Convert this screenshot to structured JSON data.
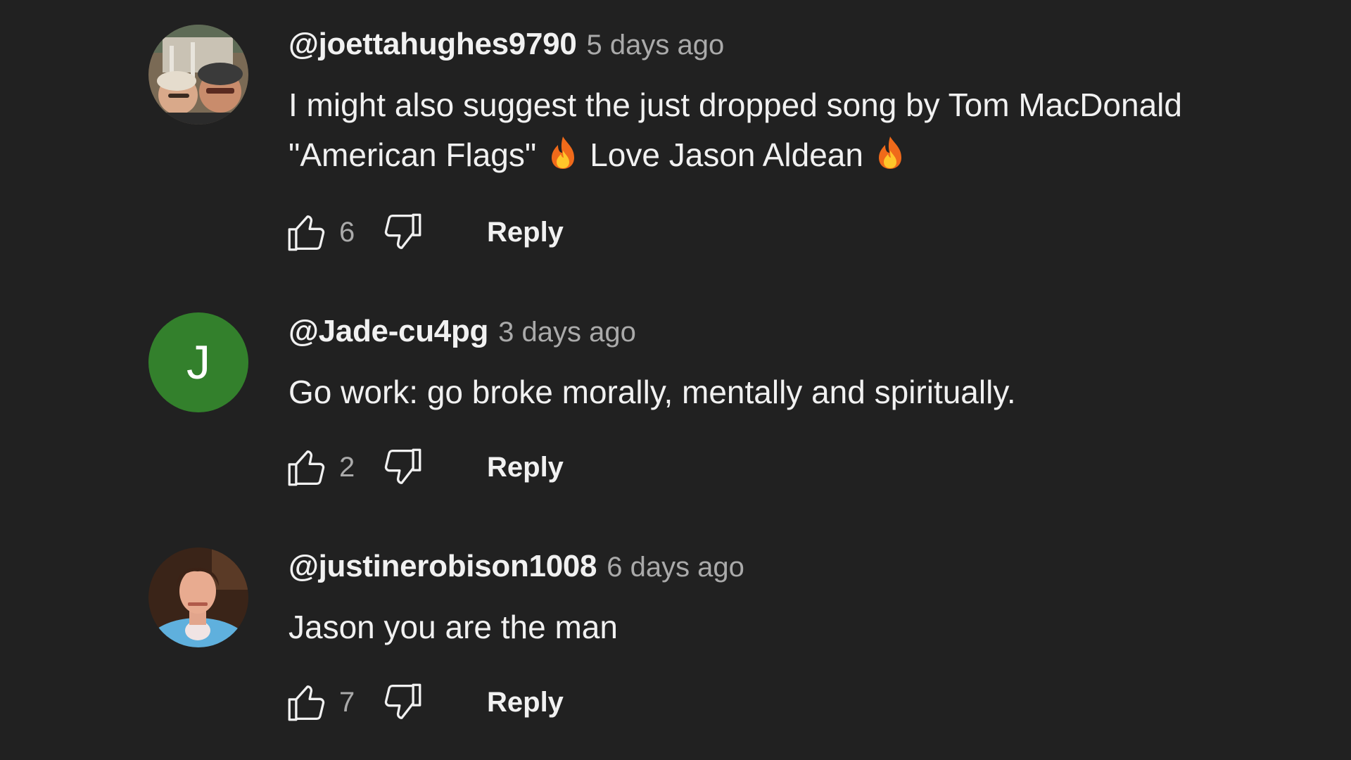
{
  "comments": [
    {
      "author": "@joettahughes9790",
      "time": "5 days ago",
      "text_part1": "I might also suggest the just dropped song by Tom MacDonald \"American Flags\"",
      "text_part2": "Love Jason Aldean",
      "emoji": "fire-emoji",
      "likes": "6",
      "reply_label": "Reply",
      "avatar_type": "photo"
    },
    {
      "author": "@Jade-cu4pg",
      "time": "3 days ago",
      "text": "Go work: go broke morally, mentally and spiritually.",
      "likes": "2",
      "reply_label": "Reply",
      "avatar_type": "letter",
      "avatar_letter": "J",
      "avatar_color": "#33802c"
    },
    {
      "author": "@justinerobison1008",
      "time": "6 days ago",
      "text": "Jason you are the man",
      "likes": "7",
      "reply_label": "Reply",
      "avatar_type": "photo"
    }
  ],
  "colors": {
    "background": "#212121",
    "primary_text": "#f1f1f1",
    "secondary_text": "#aaaaaa"
  },
  "icons": [
    "like-icon",
    "dislike-icon",
    "fire-emoji"
  ]
}
